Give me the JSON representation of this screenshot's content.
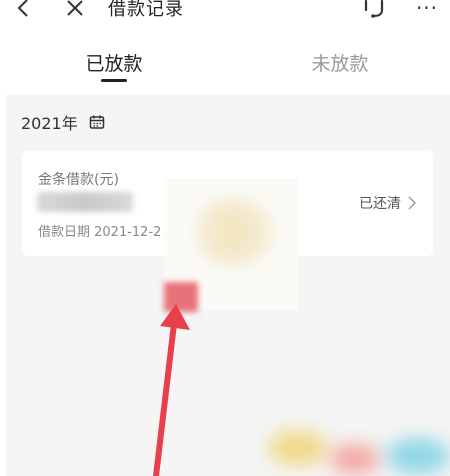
{
  "nav": {
    "title": "借款记录",
    "more_glyph": "···"
  },
  "tabs": [
    {
      "label": "已放款",
      "active": true
    },
    {
      "label": "未放款",
      "active": false
    }
  ],
  "section": {
    "year": "2021年"
  },
  "record": {
    "type": "金条借款(元)",
    "date": "借款日期 2021-12-2",
    "status": "已还清"
  },
  "colors": {
    "active_text": "#222222",
    "inactive_text": "#9a9a9a",
    "panel_bg": "#f5f5f5",
    "arrow": "#e8404a"
  },
  "icons": [
    "back-icon",
    "close-icon",
    "customer-service-icon",
    "more-icon",
    "calendar-icon",
    "chevron-right-icon"
  ]
}
